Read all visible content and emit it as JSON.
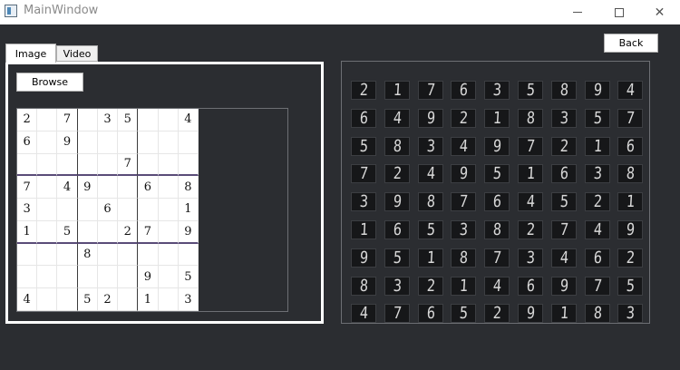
{
  "window": {
    "title": "MainWindow",
    "icon": "app-window-icon",
    "controls": [
      "minimize-icon",
      "maximize-icon",
      "close-icon"
    ]
  },
  "toolbar": {
    "back_label": "Back"
  },
  "tabs": [
    {
      "label": "Image",
      "selected": true
    },
    {
      "label": "Video",
      "selected": false
    }
  ],
  "image_tab": {
    "browse_label": "Browse"
  },
  "puzzle": [
    [
      "2",
      "",
      "7",
      "",
      "3",
      "5",
      "",
      "",
      "4"
    ],
    [
      "6",
      "",
      "9",
      "",
      "",
      "",
      "",
      "",
      ""
    ],
    [
      "",
      "",
      "",
      "",
      "",
      "7",
      "",
      "",
      ""
    ],
    [
      "7",
      "",
      "4",
      "9",
      "",
      "",
      "6",
      "",
      "8"
    ],
    [
      "3",
      "",
      "",
      "",
      "6",
      "",
      "",
      "",
      "1"
    ],
    [
      "1",
      "",
      "5",
      "",
      "",
      "2",
      "7",
      "",
      "9"
    ],
    [
      "",
      "",
      "",
      "8",
      "",
      "",
      "",
      "",
      ""
    ],
    [
      "",
      "",
      "",
      "",
      "",
      "",
      "9",
      "",
      "5"
    ],
    [
      "4",
      "",
      "",
      "5",
      "2",
      "",
      "1",
      "",
      "3"
    ]
  ],
  "solution": [
    [
      "2",
      "1",
      "7",
      "6",
      "3",
      "5",
      "8",
      "9",
      "4"
    ],
    [
      "6",
      "4",
      "9",
      "2",
      "1",
      "8",
      "3",
      "5",
      "7"
    ],
    [
      "5",
      "8",
      "3",
      "4",
      "9",
      "7",
      "2",
      "1",
      "6"
    ],
    [
      "7",
      "2",
      "4",
      "9",
      "5",
      "1",
      "6",
      "3",
      "8"
    ],
    [
      "3",
      "9",
      "8",
      "7",
      "6",
      "4",
      "5",
      "2",
      "1"
    ],
    [
      "1",
      "6",
      "5",
      "3",
      "8",
      "2",
      "7",
      "4",
      "9"
    ],
    [
      "9",
      "5",
      "1",
      "8",
      "7",
      "3",
      "4",
      "6",
      "2"
    ],
    [
      "8",
      "3",
      "2",
      "1",
      "4",
      "6",
      "9",
      "7",
      "5"
    ],
    [
      "4",
      "7",
      "6",
      "5",
      "2",
      "9",
      "1",
      "8",
      "3"
    ]
  ],
  "colors": {
    "background": "#2b2d31",
    "grid_box_line": "#5a4c78",
    "lcd_digit": "#d8d8d8"
  }
}
